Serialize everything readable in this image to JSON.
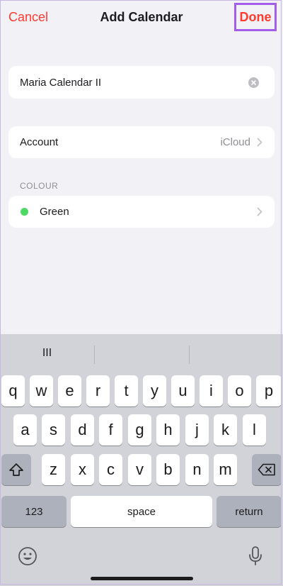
{
  "navbar": {
    "cancel_label": "Cancel",
    "title": "Add Calendar",
    "done_label": "Done"
  },
  "name_field": {
    "value": "Maria Calendar II"
  },
  "account_row": {
    "label": "Account",
    "value": "iCloud"
  },
  "colour_section": {
    "header": "COLOUR",
    "label": "Green",
    "color": "#4cd964"
  },
  "keyboard": {
    "predictions": [
      "III",
      "",
      ""
    ],
    "row1": [
      "q",
      "w",
      "e",
      "r",
      "t",
      "y",
      "u",
      "i",
      "o",
      "p"
    ],
    "row2": [
      "a",
      "s",
      "d",
      "f",
      "g",
      "h",
      "j",
      "k",
      "l"
    ],
    "row3": [
      "z",
      "x",
      "c",
      "v",
      "b",
      "n",
      "m"
    ],
    "numbers_label": "123",
    "space_label": "space",
    "return_label": "return",
    "shift_icon": "shift-icon",
    "delete_icon": "delete-icon",
    "emoji_icon": "emoji-icon",
    "dictation_icon": "microphone-icon"
  },
  "colors": {
    "accent": "#ff3b30",
    "highlight_border": "#a35de8"
  }
}
